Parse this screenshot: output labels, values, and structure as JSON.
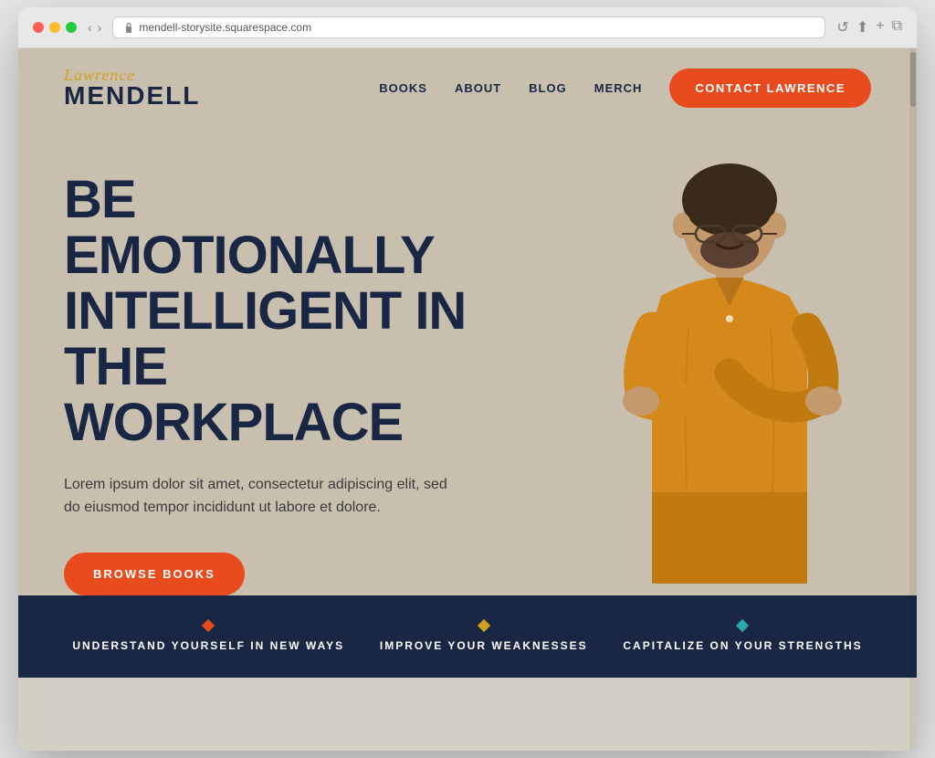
{
  "browser": {
    "url": "mendell-storysite.squarespace.com",
    "reload_icon": "↺"
  },
  "logo": {
    "script": "Lawrence",
    "main": "MENDELL"
  },
  "nav": {
    "links": [
      {
        "label": "BOOKS",
        "href": "#"
      },
      {
        "label": "ABOUT",
        "href": "#"
      },
      {
        "label": "BLOG",
        "href": "#"
      },
      {
        "label": "MERCH",
        "href": "#"
      }
    ],
    "cta_label": "CONTACT LAWRENCE"
  },
  "hero": {
    "title": "BE EMOTIONALLY INTELLIGENT IN THE WORKPLACE",
    "body": "Lorem ipsum dolor sit amet, consectetur adipiscing elit, sed do eiusmod tempor incididunt ut labore et dolore.",
    "cta_label": "BROWSE BOOKS"
  },
  "tagline_bar": {
    "items": [
      {
        "text": "UNDERSTAND YOURSELF IN NEW WAYS",
        "diamond_color": "orange"
      },
      {
        "text": "IMPROVE YOUR WEAKNESSES",
        "diamond_color": "yellow"
      },
      {
        "text": "CAPITALIZE ON YOUR STRENGTHS",
        "diamond_color": "teal"
      }
    ]
  },
  "colors": {
    "navy": "#1a2744",
    "orange": "#e84c1e",
    "gold": "#d4a020",
    "teal": "#2aa8a8",
    "bg": "#c8bfae"
  }
}
